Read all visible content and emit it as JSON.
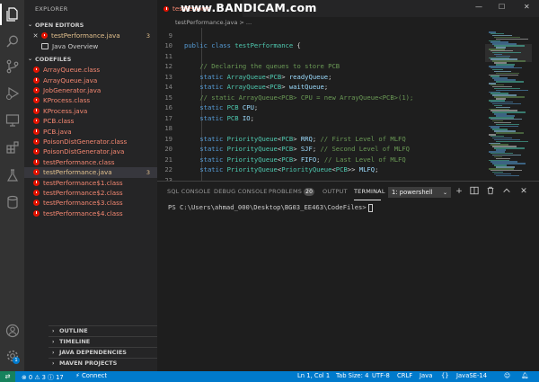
{
  "watermark": "www.BANDICAM.com",
  "window": {
    "minimize": "—",
    "maximize": "☐",
    "close": "✕"
  },
  "sidebar": {
    "title": "EXPLORER",
    "open_editors": {
      "header": "OPEN EDITORS",
      "items": [
        {
          "label": "testPerformance.java",
          "count": "3"
        },
        {
          "label": "Java Overview"
        }
      ]
    },
    "codefiles": {
      "header": "CODEFILES",
      "files": [
        "ArrayQueue.class",
        "ArrayQueue.java",
        "JobGenerator.java",
        "KProcess.class",
        "KProcess.java",
        "PCB.class",
        "PCB.java",
        "PoisonDistGenerator.class",
        "PoisonDistGenerator.java",
        "testPerformance.class",
        "testPerformance.java",
        "testPerformance$1.class",
        "testPerformance$2.class",
        "testPerformance$3.class",
        "testPerformance$4.class"
      ],
      "active_count": "3"
    },
    "bottom_sections": [
      "OUTLINE",
      "TIMELINE",
      "JAVA DEPENDENCIES",
      "MAVEN PROJECTS"
    ]
  },
  "editor": {
    "tab_label": "testPerform",
    "breadcrumb": "testPerformance.java  >  ..."
  },
  "panel": {
    "tabs": [
      "SQL CONSOLE",
      "DEBUG CONSOLE",
      "PROBLEMS",
      "OUTPUT",
      "TERMINAL"
    ],
    "problems_count": "20",
    "terminal_select": "1: powershell",
    "prompt": "PS C:\\Users\\ahmad_000\\Desktop\\BG03_EE463\\CodeFiles>"
  },
  "statusbar": {
    "errors": "0",
    "warnings": "3",
    "info": "17",
    "connect": "Connect",
    "position": "Ln 1, Col 1",
    "tab_size": "Tab Size: 4",
    "encoding": "UTF-8",
    "eol": "CRLF",
    "language": "Java",
    "jdk": "JavaSE-14"
  },
  "manage_badge": "1",
  "colors": {
    "accent": "#007acc",
    "error": "#f48771",
    "modified": "#e2c08d",
    "keyword": "#569cd6",
    "type": "#4ec9b0",
    "comment": "#6a9955"
  }
}
